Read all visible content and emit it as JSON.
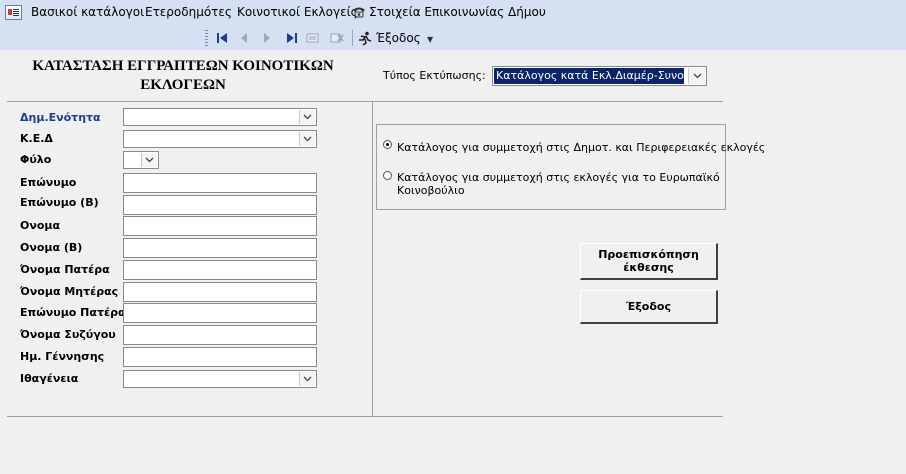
{
  "menubar": {
    "items": [
      {
        "label": "Βασικοί κατάλογοι"
      },
      {
        "label": "Ετεροδημότες"
      },
      {
        "label": "Κοινοτικοί Εκλογείς"
      },
      {
        "label": "Στοιχεία Επικοινωνίας Δήμου",
        "icon": "phone-icon"
      }
    ]
  },
  "toolbar": {
    "buttons": [
      "first-record-icon",
      "previous-record-icon",
      "next-record-icon",
      "last-record-icon",
      "new-record-icon",
      "delete-record-icon"
    ],
    "exit_label": "Έξοδος"
  },
  "form": {
    "title_line1": "ΚΑΤΑΣΤΑΣΗ ΕΓΓΡΑΠΤΕΩΝ ΚΟΙΝΟΤΙΚΩΝ",
    "title_line2": "ΕΚΛΟΓΕΩΝ",
    "print_type_label": "Τύπος Εκτύπωσης:",
    "print_type_value": "Κατάλογος κατά Εκλ.Διαμέρ-Συνοικισμό",
    "fields": [
      {
        "label": "Δημ.Ενότητα",
        "type": "combo",
        "value": ""
      },
      {
        "label": "Κ.Ε.Δ",
        "type": "combo",
        "value": ""
      },
      {
        "label": "Φύλο",
        "type": "combo-small",
        "value": ""
      },
      {
        "label": "Επώνυμο",
        "type": "text",
        "value": ""
      },
      {
        "label": "Επώνυμο (Β)",
        "type": "text",
        "value": ""
      },
      {
        "label": "Ονομα",
        "type": "text",
        "value": ""
      },
      {
        "label": "Ονομα (Β)",
        "type": "text",
        "value": ""
      },
      {
        "label": "Όνομα Πατέρα",
        "type": "text",
        "value": ""
      },
      {
        "label": "Όνομα Μητέρας",
        "type": "text",
        "value": ""
      },
      {
        "label": "Επώνυμο Πατέρα",
        "type": "text",
        "value": ""
      },
      {
        "label": "Όνομα Συζύγου",
        "type": "text",
        "value": ""
      },
      {
        "label": "Ημ. Γέννησης",
        "type": "text",
        "value": ""
      },
      {
        "label": "Ιθαγένεια",
        "type": "combo",
        "value": ""
      }
    ],
    "options": [
      {
        "label": "Κατάλογος για συμμετοχή στις Δημοτ. και Περιφερειακές εκλογές",
        "checked": true
      },
      {
        "label_line1": "Κατάλογος για συμμετοχή στις εκλογές για το Ευρωπαϊκό",
        "label_line2": "Κοινοβούλιο",
        "checked": false
      }
    ],
    "preview_button_line1": "Προεπισκόπηση",
    "preview_button_line2": "έκθεσης",
    "exit_button": "Έξοδος"
  }
}
